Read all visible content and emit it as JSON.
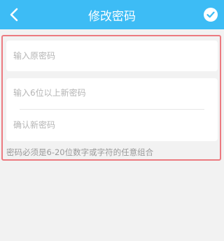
{
  "header": {
    "title": "修改密码",
    "back_icon": "chevron-left-icon",
    "confirm_icon": "check-circle-icon",
    "background_color": "#3dbcf5"
  },
  "form": {
    "old_password": {
      "placeholder": "输入原密码",
      "value": ""
    },
    "new_password": {
      "placeholder": "输入6位以上新密码",
      "value": ""
    },
    "confirm_password": {
      "placeholder": "确认新密码",
      "value": ""
    },
    "hint": "密码必须是6-20位数字或字符的任意组合",
    "highlight_color": "#ec7a80"
  }
}
